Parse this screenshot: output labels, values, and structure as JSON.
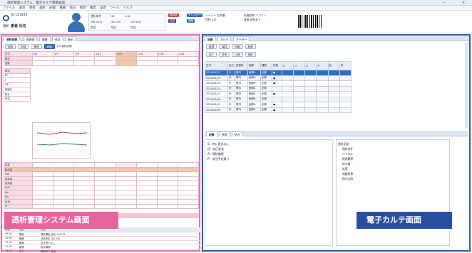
{
  "window": {
    "title": "透析管理システム　電子カルテ連携画面",
    "min": "−",
    "close": "×"
  },
  "menu": [
    "ファイル",
    "表示",
    "患者",
    "透析",
    "記録",
    "検査",
    "処方",
    "指示",
    "帳票",
    "設定",
    "ツール",
    "ヘルプ"
  ],
  "patient": {
    "type": "透析",
    "id": "ID 123456",
    "name": "患者 氏名",
    "info": [
      "透析条件",
      "HD",
      "4.0h",
      "DW 55.0",
      "QB 200",
      "QD 500",
      "前回",
      "今回",
      "次回"
    ],
    "badges": [
      "感染症",
      "アレルギー",
      "注意",
      "連絡"
    ],
    "notes": [
      "シャント 左前腕",
      "穿刺 2本",
      "抗凝固剤 ヘパリン",
      "食事 制限あり"
    ]
  },
  "left_panel": {
    "tabs": [
      "透析記録",
      "経過表",
      "検査",
      "処方",
      "指示"
    ],
    "toolbar": [
      "前回",
      "次回",
      "登録",
      "印刷",
      "HD 透析記録"
    ],
    "grid_label_col": [
      "日付",
      "曜日",
      "回数",
      "時刻",
      "BP",
      "P",
      "QB",
      "静脈圧",
      "除水",
      "体温"
    ],
    "grid_dates": [
      "1/5",
      "1/7",
      "1/9",
      "1/12",
      "1/14",
      "1/16",
      "1/19",
      "1/21"
    ],
    "rows": [
      "体重",
      "除水量",
      "DW",
      "前体重",
      "後体重",
      "Kt/V",
      "Hb",
      "Alb",
      "BUN",
      "Cr"
    ],
    "log_headers": [
      "時刻",
      "項目",
      "内容"
    ],
    "log_rows": [
      [
        "09:00",
        "開始",
        "透析開始 血圧 142/78"
      ],
      [
        "10:00",
        "観察",
        "状態安定 QB 200"
      ],
      [
        "11:00",
        "観察",
        "血圧低下なし"
      ],
      [
        "12:00",
        "観察",
        "除水順調"
      ],
      [
        "13:00",
        "終了",
        "透析終了 返血"
      ]
    ],
    "overlay_label": "透析管理システム画面"
  },
  "right_panel": {
    "tabs": [
      "記録",
      "カルテ",
      "オーダー"
    ],
    "toolbar": [
      "新規",
      "保存",
      "印刷",
      "検索"
    ],
    "filters": [
      "全て",
      "外来",
      "入院",
      "透析"
    ],
    "table_headers": [
      "日付",
      "区分",
      "診療科",
      "医師",
      "種別",
      "状態",
      "S",
      "O",
      "A",
      "P",
      "記",
      "承"
    ],
    "table_rows": [
      [
        "2024/01/21",
        "外",
        "腎内",
        "医師A",
        "記録",
        "●"
      ],
      [
        "2024/01/19",
        "外",
        "腎内",
        "医師A",
        "記録",
        "●"
      ],
      [
        "2024/01/16",
        "外",
        "腎内",
        "医師B",
        "記録",
        "●"
      ],
      [
        "2024/01/14",
        "外",
        "腎内",
        "医師A",
        "記録",
        ""
      ],
      [
        "2024/01/12",
        "外",
        "腎内",
        "医師A",
        "記録",
        "●"
      ],
      [
        "2024/01/09",
        "外",
        "腎内",
        "医師B",
        "記録",
        ""
      ],
      [
        "2024/01/07",
        "外",
        "腎内",
        "医師A",
        "記録",
        "●"
      ],
      [
        "2024/01/05",
        "外",
        "腎内",
        "医師A",
        "記録",
        "●"
      ]
    ],
    "editor_tabs": [
      "記事",
      "所見",
      "処方"
    ],
    "editor_lines": [
      "S）特に変化なし",
      "O）血圧安定",
      "A）透析継続",
      "P）次回予定通り"
    ],
    "tree_nodes": [
      "透析記録",
      "透析条件",
      "バイタル",
      "経過観察",
      "除水量",
      "処置",
      "検査結果",
      "指示内容"
    ],
    "overlay_label": "電子カルテ画面"
  }
}
